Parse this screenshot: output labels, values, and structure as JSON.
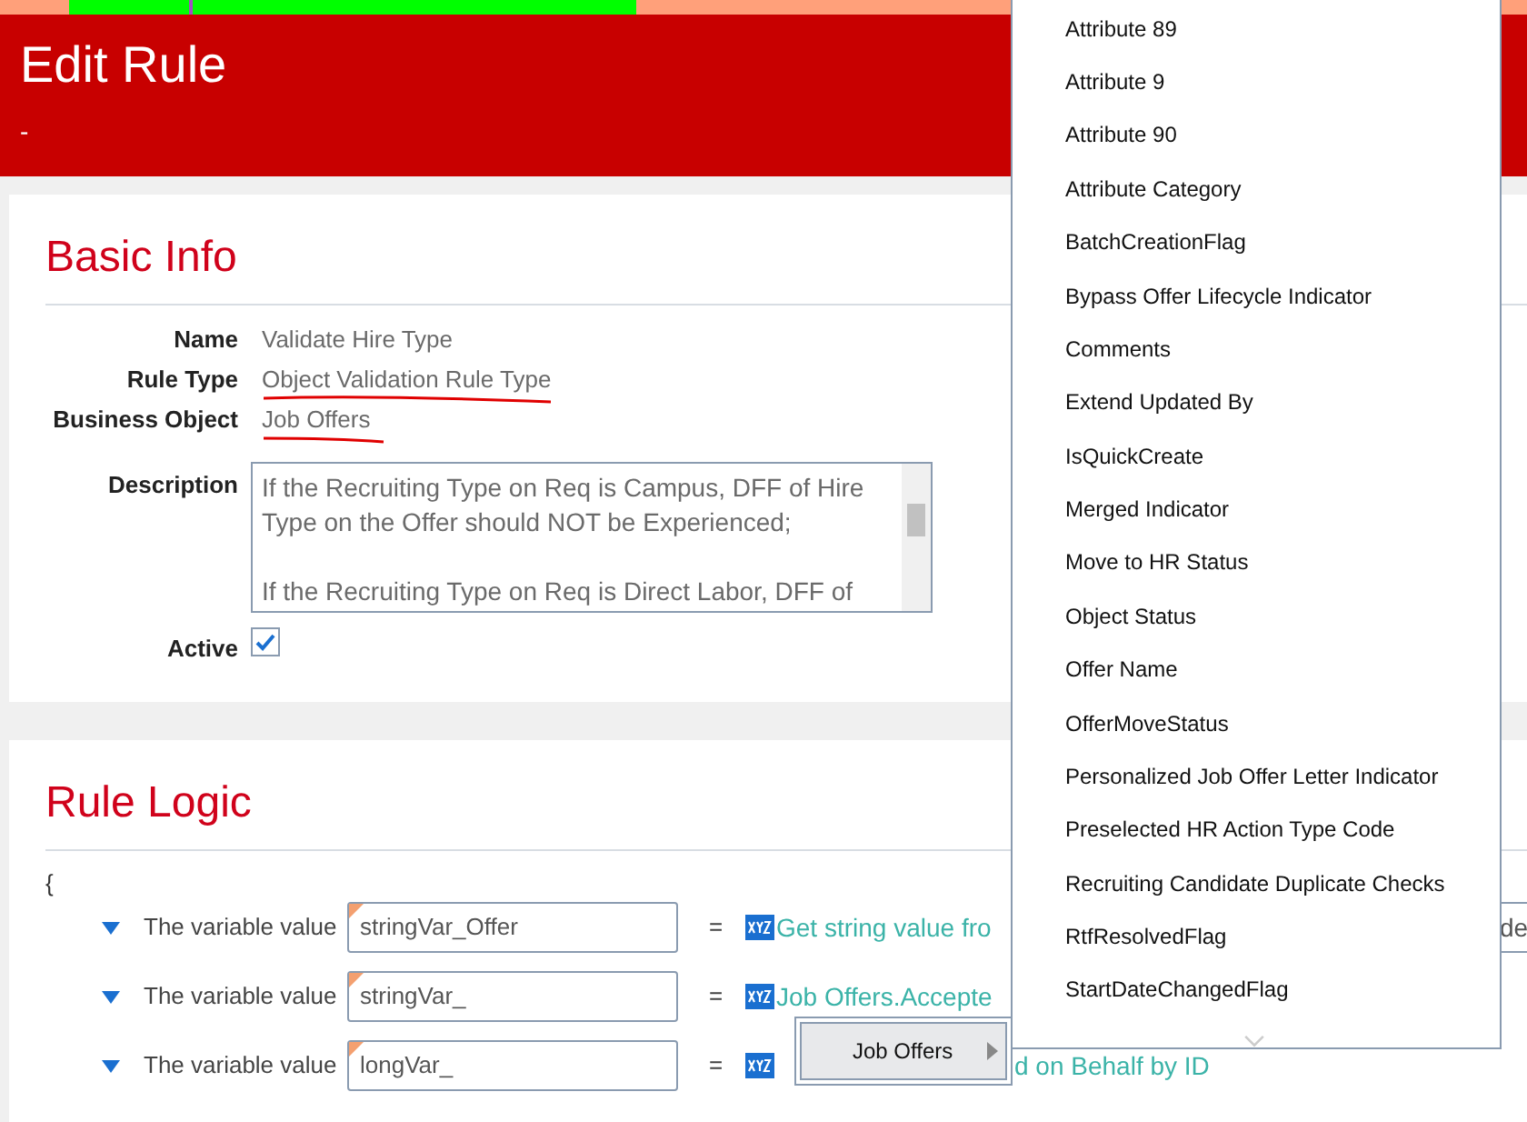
{
  "header": {
    "title": "Edit Rule",
    "subtitle": "-"
  },
  "basic_info": {
    "title": "Basic Info",
    "fields": [
      {
        "label": "Name",
        "value": "Validate Hire Type",
        "underlined": false
      },
      {
        "label": "Rule Type",
        "value": "Object Validation Rule Type",
        "underlined": true
      },
      {
        "label": "Business Object",
        "value": "Job Offers",
        "underlined": true
      }
    ],
    "description": {
      "label": "Description",
      "value": "If the Recruiting Type on Req is Campus, DFF of Hire Type on the Offer should NOT be Experienced;\n\nIf the Recruiting Type on Req is Direct Labor, DFF of"
    },
    "active": {
      "label": "Active",
      "checked": true
    }
  },
  "rule_logic": {
    "title": "Rule Logic",
    "open_brace": "{",
    "rows": [
      {
        "label": "The variable value",
        "variable": "stringVar_Offer",
        "equals": "=",
        "expression": "Get string value fro",
        "column_3": "de"
      },
      {
        "label": "The variable value",
        "variable": "stringVar_",
        "equals": "=",
        "expression": "Job Offers.Accepte"
      },
      {
        "label": "The variable value",
        "variable": "longVar_",
        "equals": "=",
        "expression": "d on Behalf by ID"
      }
    ]
  },
  "submenu": {
    "label": "Job Offers"
  },
  "menu": {
    "items": [
      "Attribute 89",
      "Attribute 9",
      "Attribute 90",
      "Attribute Category",
      "BatchCreationFlag",
      "Bypass Offer Lifecycle Indicator",
      "Comments",
      "Extend Updated By",
      "IsQuickCreate",
      "Merged Indicator",
      "Move to HR Status",
      "Object Status",
      "Offer Name",
      "OfferMoveStatus",
      "Personalized Job Offer Letter Indicator",
      "Preselected HR Action Type Code",
      "Recruiting Candidate Duplicate Checks",
      "RtfResolvedFlag",
      "StartDateChangedFlag"
    ]
  }
}
